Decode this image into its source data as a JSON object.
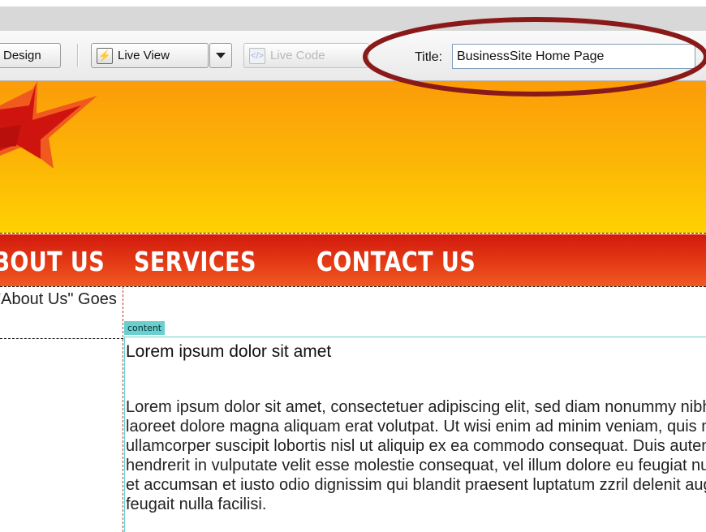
{
  "toolbar": {
    "design_label": "Design",
    "live_view_label": "Live View",
    "live_code_label": "Live Code",
    "title_label": "Title:",
    "title_value": "BusinessSite Home Page"
  },
  "nav": {
    "items": [
      "ABOUT US",
      "SERVICES",
      "CONTACT US"
    ]
  },
  "sidebar": {
    "text": "\"About Us\" Goes"
  },
  "content": {
    "tag": "content",
    "heading": "Lorem ipsum dolor sit amet",
    "lines": [
      "Lorem ipsum dolor sit amet, consectetuer adipiscing elit, sed diam nonummy nibh euismod tincidunt ut",
      "laoreet dolore magna aliquam erat volutpat. Ut wisi enim ad minim veniam, quis nostrud exerci tation",
      "ullamcorper suscipit lobortis nisl ut aliquip ex ea commodo consequat. Duis autem vel eum iriure dolor in",
      "hendrerit in vulputate velit esse molestie consequat, vel illum dolore eu feugiat nulla facilisis at vero eros",
      "et accumsan et iusto odio dignissim qui blandit praesent luptatum zzril delenit augue duis dolore te",
      "feugait nulla facilisi."
    ]
  },
  "colors": {
    "annotation": "#8a1a1a",
    "nav_bar": "#e03010",
    "banner": "#fcb406",
    "content_outline": "#6bcfcf"
  }
}
